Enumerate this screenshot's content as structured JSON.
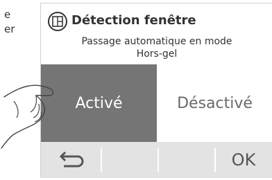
{
  "background_text": {
    "line1": "e",
    "line2": "er"
  },
  "header": {
    "icon": "window-icon",
    "title": "Détection fenêtre",
    "subtitle_line1": "Passage automatique en mode",
    "subtitle_line2": "Hors-gel"
  },
  "choices": {
    "selected_label": "Activé",
    "other_label": "Désactivé"
  },
  "bottom_bar": {
    "back_icon": "back-arrow-icon",
    "ok_label": "OK"
  },
  "colors": {
    "selected_bg": "#757575",
    "bar_bg": "#e3e3e3",
    "text": "#333333"
  }
}
